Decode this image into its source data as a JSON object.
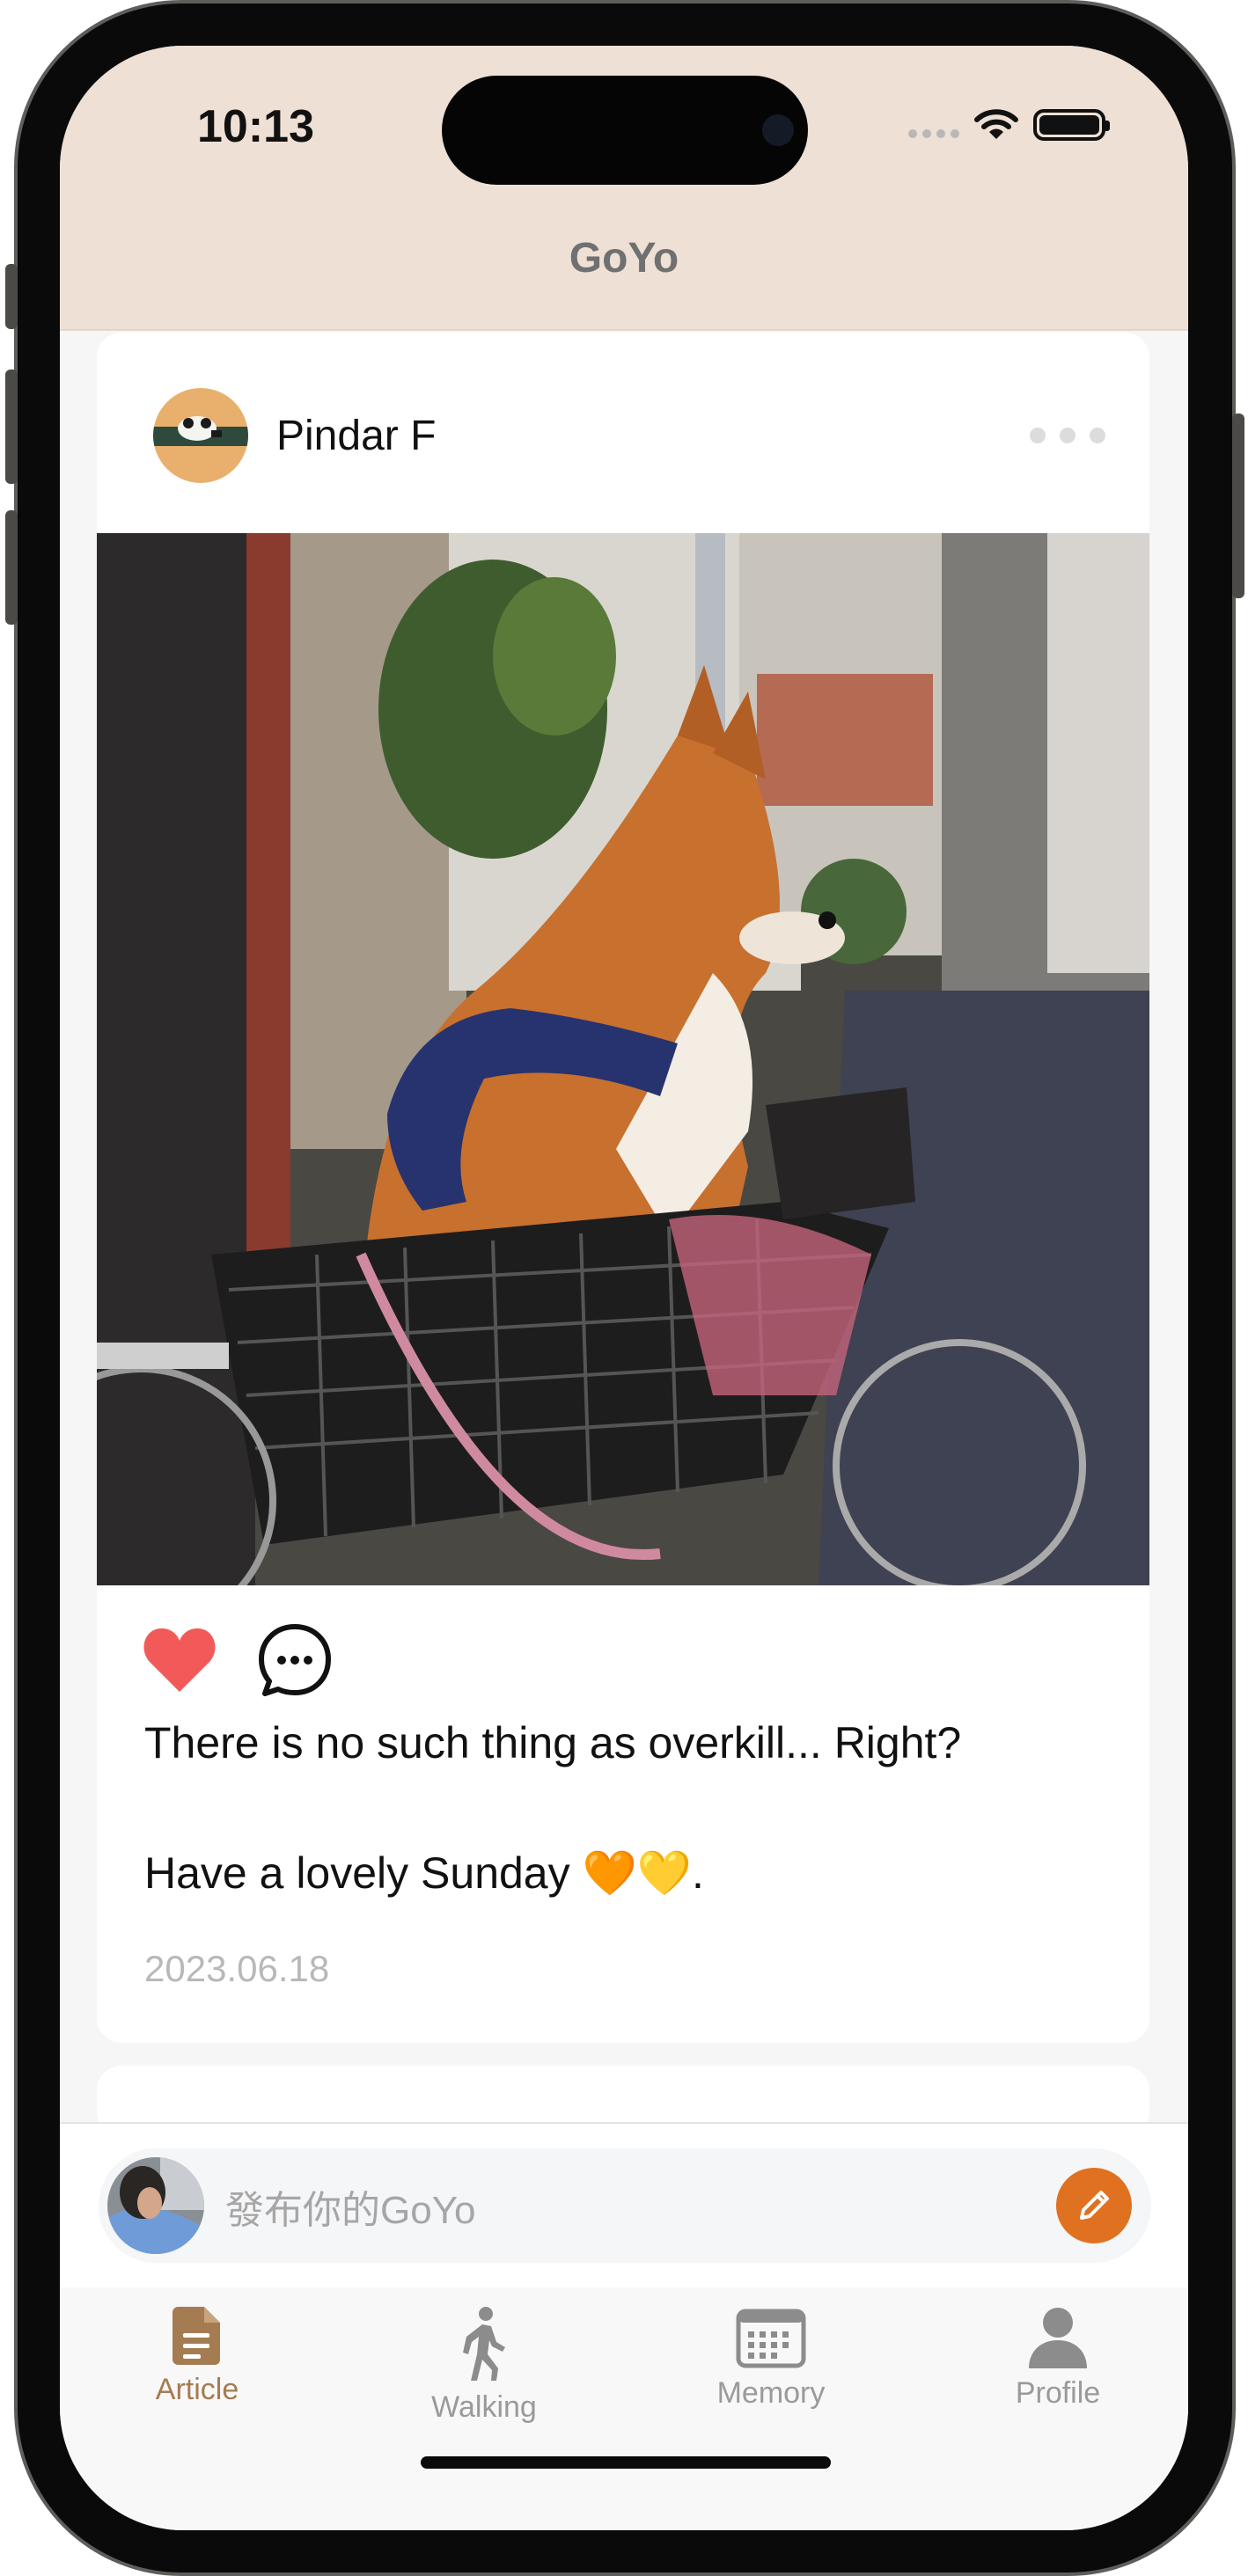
{
  "status_bar": {
    "time": "10:13"
  },
  "header": {
    "title": "GoYo"
  },
  "post": {
    "author": "Pindar F",
    "liked": true,
    "text_line1": "There is no such thing as overkill... Right?",
    "text_line2": "Have a lovely Sunday 🧡💛.",
    "date": "2023.06.18",
    "image": "shiba inu dog sitting in a bicycle basket on a city street",
    "icons": [
      "heart-icon",
      "comment-icon",
      "more-icon"
    ]
  },
  "composer": {
    "placeholder": "發布你的GoYo",
    "button_icon": "pencil-icon"
  },
  "tabs": [
    {
      "label": "Article",
      "icon": "document-icon",
      "active": true
    },
    {
      "label": "Walking",
      "icon": "walking-icon",
      "active": false
    },
    {
      "label": "Memory",
      "icon": "calendar-icon",
      "active": false
    },
    {
      "label": "Profile",
      "icon": "person-icon",
      "active": false
    }
  ],
  "colors": {
    "accent": "#a57c52",
    "heart": "#f25a5a",
    "compose_button": "#e07120",
    "header_bg": "#eee0d4"
  }
}
